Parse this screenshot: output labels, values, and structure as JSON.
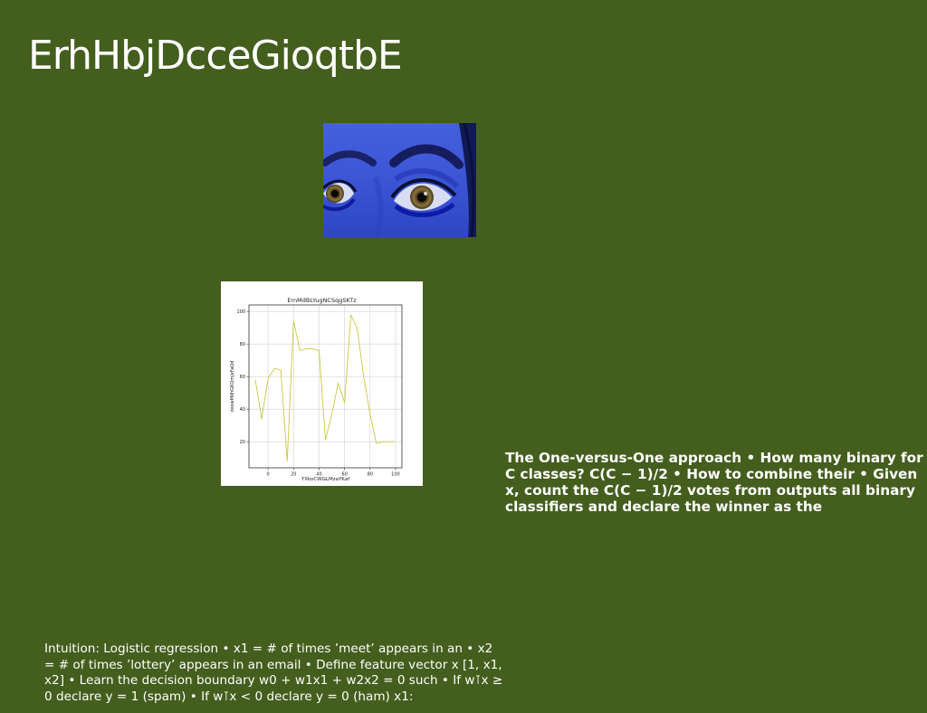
{
  "slide": {
    "title": "ErhHbjDcceGioqtbE",
    "right_text": "The One-versus-One approach • How many binary for C classes? C(C − 1)/2 • How to combine their • Given x, count the C(C − 1)/2 votes from outputs all binary classifiers and declare the winner as the",
    "bottom_text": "Intuition: Logistic regression • x1 = # of times ’meet’ appears in an • x2 = # of times ’lottery’ appears in an email • Define feature vector x [1, x1, x2] • Learn the decision boundary w0 + w1x1 + w2x2 = 0 such • If w⊺x ≥ 0 declare y = 1 (spam) • If w⊺x < 0 declare y = 0 (ham) x1:"
  },
  "photo": {
    "subject": "close-up-of-eyes-with-blue-makeup",
    "tint_color": "#3a56d8"
  },
  "chart_data": {
    "type": "line",
    "title": "ErnMdBLYugNCSqgSKTz",
    "xlabel": "YXkoCWGLMzaYKaf",
    "ylabel": "zeowMdhGKQmjeFaQd",
    "x": [
      -10,
      -5,
      0,
      5,
      10,
      15,
      20,
      25,
      30,
      35,
      40,
      45,
      50,
      55,
      60,
      65,
      70,
      75,
      80,
      85,
      90,
      95,
      100
    ],
    "series": [
      {
        "values": [
          58,
          34,
          59,
          65,
          64,
          8,
          94,
          76,
          77,
          77,
          76,
          21,
          37,
          56,
          44,
          98,
          89,
          60,
          37,
          19,
          20,
          20,
          20
        ]
      }
    ],
    "xlim": [
      -15,
      105
    ],
    "ylim": [
      4,
      104
    ],
    "xticks": [
      0,
      20,
      40,
      60,
      80,
      100
    ],
    "yticks": [
      20,
      40,
      60,
      80,
      100
    ],
    "grid": true,
    "line_color": "#c8c840"
  }
}
